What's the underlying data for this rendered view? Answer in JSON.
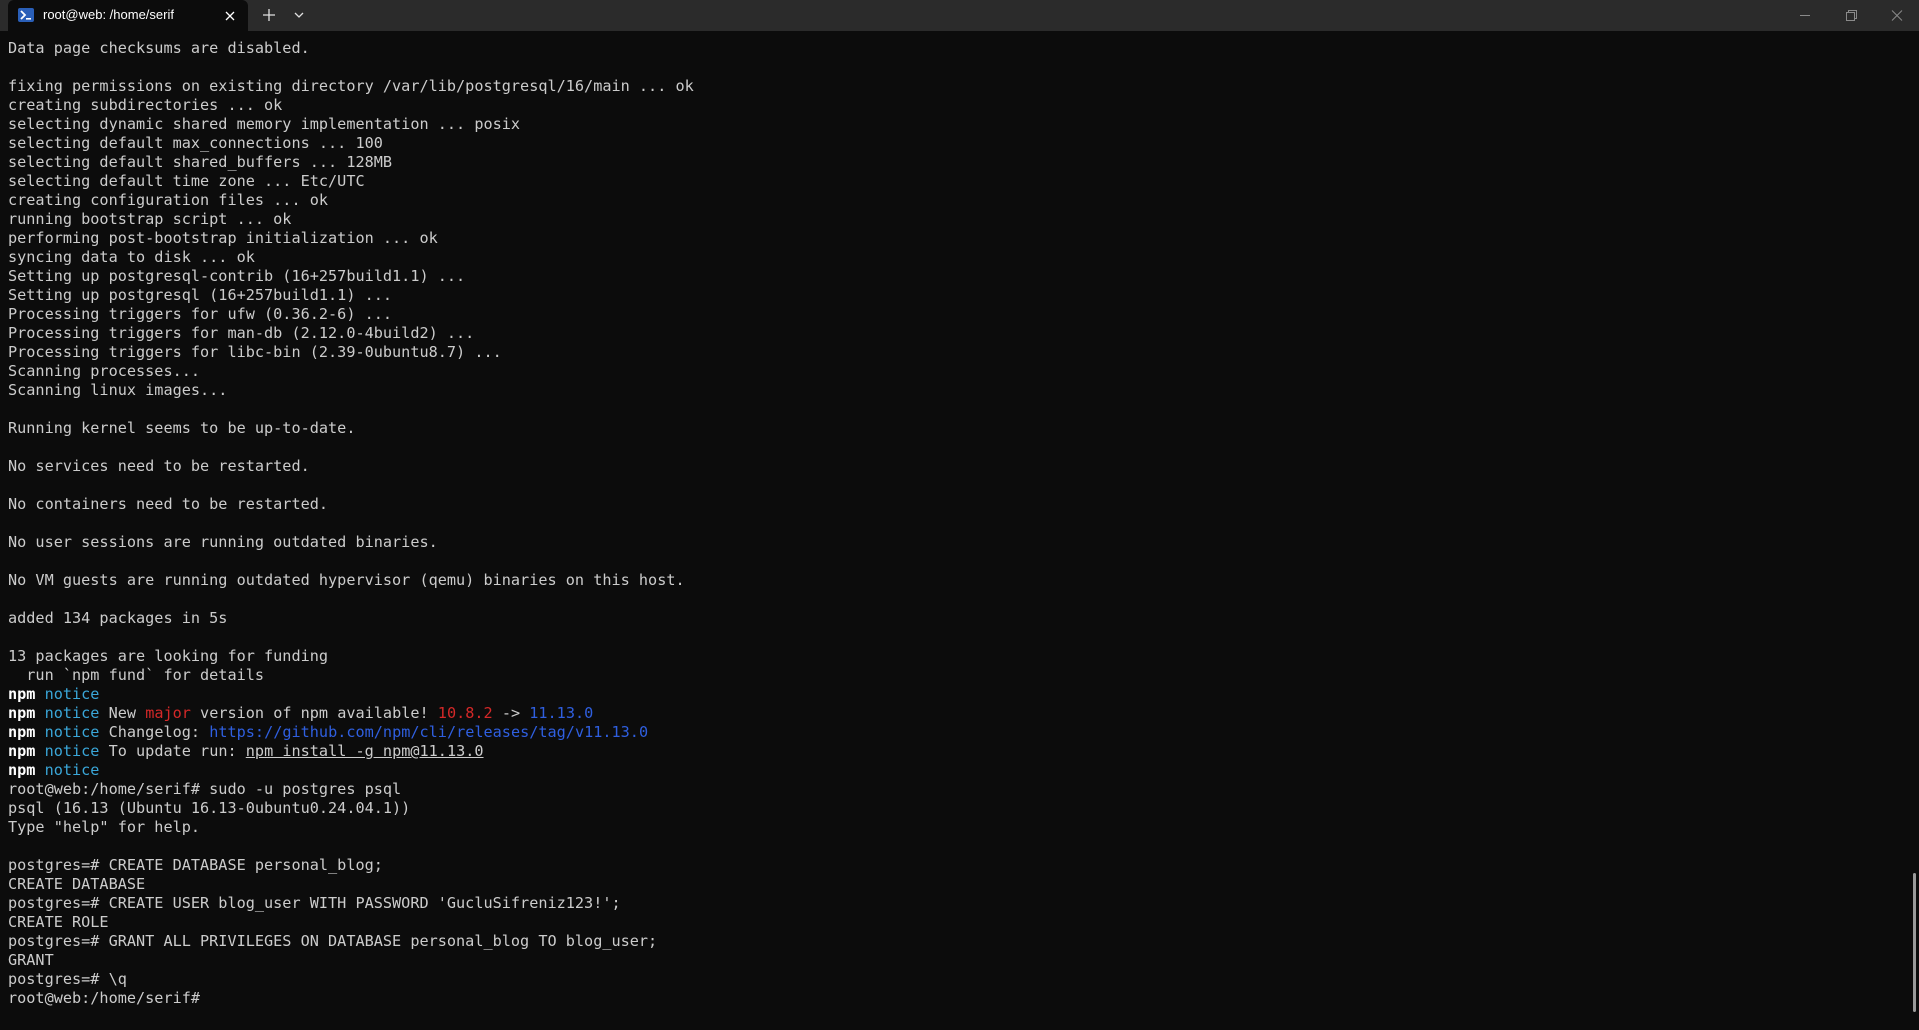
{
  "titlebar": {
    "tab_title": "root@web: /home/serif",
    "tab_icon": "powershell-terminal-icon",
    "close_tab_icon": "close-icon",
    "new_tab_icon": "plus-icon",
    "dropdown_icon": "chevron-down-icon",
    "window_controls": [
      "minimize-icon",
      "restore-icon",
      "close-icon"
    ]
  },
  "terminal": {
    "lines": [
      {
        "text": "Data page checksums are disabled."
      },
      {
        "text": ""
      },
      {
        "text": "fixing permissions on existing directory /var/lib/postgresql/16/main ... ok"
      },
      {
        "text": "creating subdirectories ... ok"
      },
      {
        "text": "selecting dynamic shared memory implementation ... posix"
      },
      {
        "text": "selecting default max_connections ... 100"
      },
      {
        "text": "selecting default shared_buffers ... 128MB"
      },
      {
        "text": "selecting default time zone ... Etc/UTC"
      },
      {
        "text": "creating configuration files ... ok"
      },
      {
        "text": "running bootstrap script ... ok"
      },
      {
        "text": "performing post-bootstrap initialization ... ok"
      },
      {
        "text": "syncing data to disk ... ok"
      },
      {
        "text": "Setting up postgresql-contrib (16+257build1.1) ..."
      },
      {
        "text": "Setting up postgresql (16+257build1.1) ..."
      },
      {
        "text": "Processing triggers for ufw (0.36.2-6) ..."
      },
      {
        "text": "Processing triggers for man-db (2.12.0-4build2) ..."
      },
      {
        "text": "Processing triggers for libc-bin (2.39-0ubuntu8.7) ..."
      },
      {
        "text": "Scanning processes..."
      },
      {
        "text": "Scanning linux images..."
      },
      {
        "text": ""
      },
      {
        "text": "Running kernel seems to be up-to-date."
      },
      {
        "text": ""
      },
      {
        "text": "No services need to be restarted."
      },
      {
        "text": ""
      },
      {
        "text": "No containers need to be restarted."
      },
      {
        "text": ""
      },
      {
        "text": "No user sessions are running outdated binaries."
      },
      {
        "text": ""
      },
      {
        "text": "No VM guests are running outdated hypervisor (qemu) binaries on this host."
      },
      {
        "text": ""
      },
      {
        "text": "added 134 packages in 5s"
      },
      {
        "text": ""
      },
      {
        "text": "13 packages are looking for funding"
      },
      {
        "text": "  run `npm fund` for details"
      },
      {
        "npm": "npm",
        "notice": "notice",
        "text": ""
      },
      {
        "npm": "npm",
        "notice": "notice",
        "t1": " New ",
        "major": "major",
        "t2": " version of npm available! ",
        "old_version": "10.8.2",
        "arrow": " -> ",
        "new_version": "11.13.0"
      },
      {
        "npm": "npm",
        "notice": "notice",
        "t1": " Changelog: ",
        "url": "https://github.com/npm/cli/releases/tag/v11.13.0"
      },
      {
        "npm": "npm",
        "notice": "notice",
        "t1": " To update run: ",
        "cmd": "npm install -g npm@11.13.0"
      },
      {
        "npm": "npm",
        "notice": "notice",
        "text": ""
      },
      {
        "text": "root@web:/home/serif# sudo -u postgres psql"
      },
      {
        "text": "psql (16.13 (Ubuntu 16.13-0ubuntu0.24.04.1))"
      },
      {
        "text": "Type \"help\" for help."
      },
      {
        "text": ""
      },
      {
        "text": "postgres=# CREATE DATABASE personal_blog;"
      },
      {
        "text": "CREATE DATABASE"
      },
      {
        "text": "postgres=# CREATE USER blog_user WITH PASSWORD 'GucluSifreniz123!';"
      },
      {
        "text": "CREATE ROLE"
      },
      {
        "text": "postgres=# GRANT ALL PRIVILEGES ON DATABASE personal_blog TO blog_user;"
      },
      {
        "text": "GRANT"
      },
      {
        "text": "postgres=# \\q"
      },
      {
        "text": "root@web:/home/serif# "
      }
    ]
  },
  "colors": {
    "background": "#0c0c0c",
    "foreground": "#cccccc",
    "npm_bold": "#ffffff",
    "notice_cyan": "#3aa6d8",
    "major_red": "#d42828",
    "link_blue": "#2f5fe0",
    "titlebar": "#2b2b2b"
  }
}
